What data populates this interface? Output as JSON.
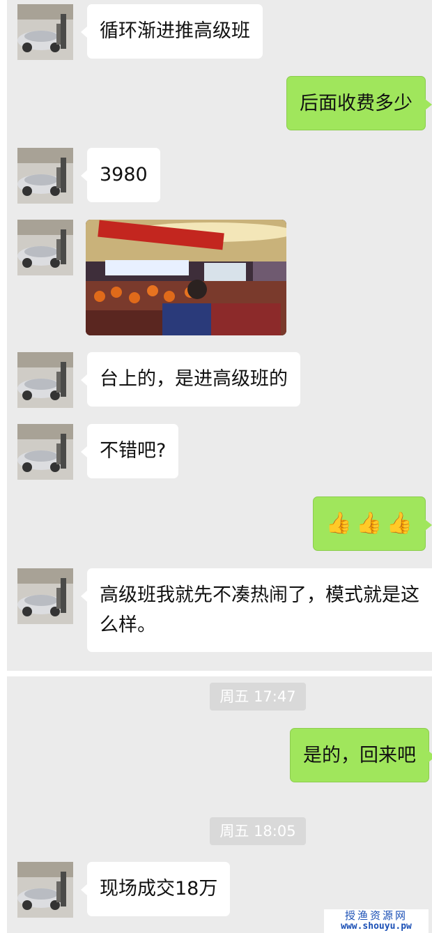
{
  "chat": {
    "messages": [
      {
        "side": "left",
        "text": "循环渐进推高级班"
      },
      {
        "side": "right",
        "text": "后面收费多少"
      },
      {
        "side": "left",
        "text": "3980"
      },
      {
        "side": "left",
        "type": "image",
        "text": ""
      },
      {
        "side": "left",
        "text": "台上的，是进高级班的"
      },
      {
        "side": "left",
        "text": "不错吧?"
      },
      {
        "side": "right",
        "type": "emoji",
        "emoji": [
          "👍",
          "👍",
          "👍"
        ]
      },
      {
        "side": "left",
        "text": "高级班我就先不凑热闹了，模式就是这么样。"
      }
    ],
    "timestamp_1": "周五 17:47",
    "messages_2": [
      {
        "side": "right",
        "text": "是的，回来吧"
      }
    ],
    "timestamp_2": "周五 18:05",
    "messages_3": [
      {
        "side": "left",
        "text": "现场成交18万"
      }
    ]
  },
  "watermark": {
    "site_name": "授渔资源网",
    "url": "www.shouyu.pw"
  },
  "colors": {
    "chat_bg": "#ebebeb",
    "bubble_self": "#a0e65c",
    "bubble_other": "#ffffff",
    "watermark": "#1a4fb5"
  }
}
